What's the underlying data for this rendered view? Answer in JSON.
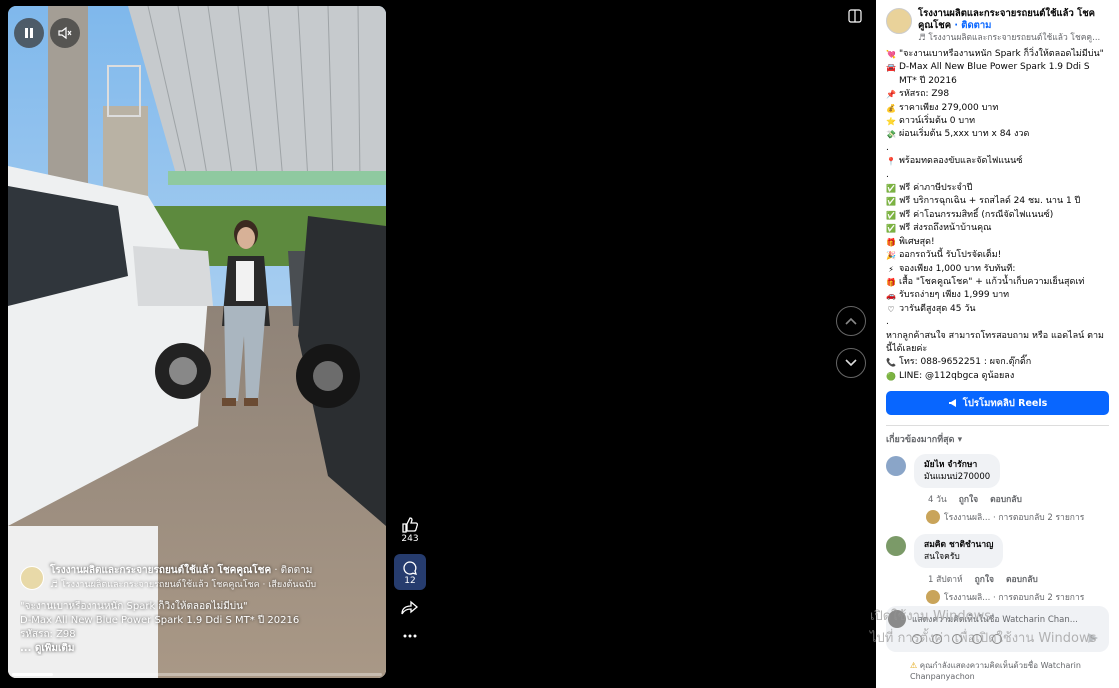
{
  "video": {
    "overlay": {
      "page_name": "โรงงานผลิตและกระจายรถยนต์ใช้แล้ว โชคคูณโชค",
      "follow": "· ติดตาม",
      "audio": "♬ โรงงานผลิตและกระจายรถยนต์ใช้แล้ว โชคคูณโชค · เสียงต้นฉบับ",
      "lines": [
        "\"จะงานเบาหรืองานหนัก Spark ก็วิ่งให้ตลอดไม่มีบ่น\"",
        "D-Max All New Blue Power Spark 1.9 Ddi S MT* ปี 20216",
        "รหัสรถ: Z98"
      ],
      "more": "... ดูเพิ่มเติม"
    },
    "progress_fraction": 0.11
  },
  "actions": {
    "likes": "243",
    "comments": "12"
  },
  "panel": {
    "page_title": "โรงงานผลิตและกระจายรถยนต์ใช้แล้ว โชคคูณโชค",
    "follow": "· ติดตาม",
    "audio": "♬ โรงงานผลิตและกระจายรถยนต์ใช้แล้ว โชคคู...",
    "caption": [
      {
        "emoji": "💘",
        "text": "\"จะงานเบาหรืองานหนัก Spark ก็วิ่งให้ตลอดไม่มีบ่น\""
      },
      {
        "emoji": "🚘",
        "text": "D-Max All New Blue Power Spark 1.9 Ddi S MT* ปี 20216"
      },
      {
        "emoji": "📌",
        "text": "รหัสรถ: Z98"
      },
      {
        "emoji": "💰",
        "text": "ราคาเพียง 279,000 บาท"
      },
      {
        "emoji": "⭐",
        "text": "ดาวน์เริ่มต้น 0 บาท"
      },
      {
        "emoji": "💸",
        "text": "ผ่อนเริ่มต้น 5,xxx บาท x 84 งวด"
      },
      {
        "emoji": "",
        "text": "."
      },
      {
        "emoji": "📍",
        "text": "พร้อมทดลองขับและจัดไฟแนนซ์"
      },
      {
        "emoji": "",
        "text": "."
      },
      {
        "emoji": "✅",
        "text": "ฟรี ค่าภาษีประจำปี"
      },
      {
        "emoji": "✅",
        "text": "ฟรี บริการฉุกเฉิน + รถสไลด์ 24 ชม. นาน 1 ปี"
      },
      {
        "emoji": "✅",
        "text": "ฟรี ค่าโอนกรรมสิทธิ์ (กรณีจัดไฟแนนซ์)"
      },
      {
        "emoji": "✅",
        "text": "ฟรี ส่งรถถึงหน้าบ้านคุณ"
      },
      {
        "emoji": "🎁",
        "text": "พิเศษสุด!"
      },
      {
        "emoji": "🎉",
        "text": "ออกรถวันนี้ รับโปรจัดเต็ม!"
      },
      {
        "emoji": "⚡",
        "text": "จองเพียง 1,000 บาท รับทันที:"
      },
      {
        "emoji": "🎁",
        "text": "เสื้อ \"โชคคูณโชค\" + แก้วน้ำเก็บความเย็นสุดเท่"
      },
      {
        "emoji": "🚗",
        "text": "รับรถง่ายๆ เพียง 1,999 บาท"
      },
      {
        "emoji": "♡",
        "text": "วารันตีสูงสุด 45 วัน"
      },
      {
        "emoji": "",
        "text": "."
      },
      {
        "emoji": "",
        "text": "หากลูกค้าสนใจ สามารถโทรสอบถาม หรือ แอดไลน์ ตามนี้ได้เลยค่ะ"
      },
      {
        "emoji": "📞",
        "text": "โทร: 088-9652251 : ผจก.ตุ๊กติ๊ก"
      },
      {
        "emoji": "🟢",
        "text": "LINE: @112qbgca ดูน้อยลง"
      }
    ],
    "promo_button": "โปรโมทคลิป Reels",
    "sort_label": "เกี่ยวข้องมากที่สุด ▾",
    "comments": [
      {
        "name": "มัยไห จำรักษา",
        "text": "มันแมนบ่270000",
        "time": "4 วัน",
        "like": "ถูกใจ",
        "reply": "ตอบกลับ",
        "reply_summary": "โรงงานผลิ... · การตอบกลับ 2 รายการ"
      },
      {
        "name": "สมคิด ชาติชำนาญ",
        "text": "สนใจครับ",
        "time": "1 สัปดาห์",
        "like": "ถูกใจ",
        "reply": "ตอบกลับ",
        "reply_summary": "โรงงานผลิ... · การตอบกลับ 2 รายการ"
      }
    ],
    "composer_placeholder": "แสดงความคิดเห็นในชื่อ Watcharin Chan...",
    "notice": "คุณกำลังแสดงความคิดเห็นด้วยชื่อ Watcharin Chanpanyachon"
  },
  "watermark": {
    "line1": "เปิดใช้งาน Windows",
    "line2": "ไปที่ การตั้งค่า เพื่อเปิดใช้งาน Windows"
  }
}
